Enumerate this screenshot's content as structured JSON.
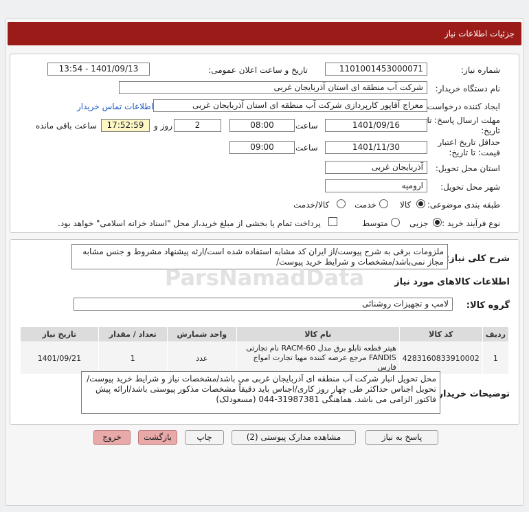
{
  "header": {
    "title": "جزئیات اطلاعات نیاز"
  },
  "form": {
    "need_number": {
      "label": "شماره نیاز:",
      "value": "1101001453000071"
    },
    "announce_datetime": {
      "label": "تاریخ و ساعت اعلان عمومی:",
      "value": "1401/09/13 - 13:54"
    },
    "buyer_org": {
      "label": "نام دستگاه خریدار:",
      "value": "شرکت آب منطقه ای استان آذربایجان غربی"
    },
    "requester": {
      "label": "ایجاد کننده درخواست:",
      "value": "معراج آقاپور کارپردازی شرکت آب منطقه ای استان آذربایجان غربی",
      "contact_link": "اطلاعات تماس خریدار"
    },
    "deadline": {
      "label_line1": "مهلت ارسال پاسخ: تا",
      "label_line2": "تاریخ:",
      "date": "1401/09/16",
      "time_label": "ساعت",
      "time": "08:00",
      "days": "2",
      "days_label": "روز و",
      "remaining": "17:52:59",
      "remaining_label": "ساعت باقی مانده"
    },
    "price_validity": {
      "label_line1": "حداقل تاریخ اعتبار",
      "label_line2": "قیمت: تا تاریخ:",
      "date": "1401/11/30",
      "time_label": "ساعت",
      "time": "09:00"
    },
    "province": {
      "label": "استان محل تحویل:",
      "value": "آذربایجان غربی"
    },
    "city": {
      "label": "شهر محل تحویل:",
      "value": "ارومیه"
    },
    "category": {
      "label": "طبقه بندی موضوعی:",
      "options": [
        "کالا",
        "خدمت",
        "کالا/خدمت"
      ],
      "selected": "کالا"
    },
    "purchase_type": {
      "label": "نوع فرآیند خرید :",
      "options": [
        "جزیی",
        "متوسط"
      ],
      "selected": "جزیی",
      "payment_note": "پرداخت تمام یا بخشی از مبلغ خرید،از محل \"اسناد خزانه اسلامی\" خواهد بود."
    }
  },
  "summary": {
    "label": "شرح کلی نیاز:",
    "text": "ملزومات برقی به شرح پیوست/از ایران کد مشابه استفاده شده است/ارئه پیشنهاد مشروط و جنس مشابه مجاز نمی‌باشد/مشخصات و شرایط خرید پیوست/"
  },
  "goods_section": {
    "title": "اطلاعات کالاهای مورد نیاز",
    "group_label": "گروه کالا:",
    "group_value": "لامپ و تجهیزات روشنائی"
  },
  "table": {
    "headers": [
      "ردیف",
      "کد کالا",
      "نام کالا",
      "واحد شمارش",
      "تعداد / مقدار",
      "تاریخ نیاز"
    ],
    "rows": [
      {
        "row": "1",
        "code": "4283160833910002",
        "name": "هیتر قطعه تابلو برق مدل RACM-60 نام تجارتی FANDIS مرجع عرضه کننده مهیا تجارت امواج فارس",
        "unit": "عدد",
        "qty": "1",
        "date": "1401/09/21"
      }
    ]
  },
  "buyer_notes": {
    "label": "توضیحات خریدار:",
    "text": "محل تحویل انبار شرکت آب منطقه ای آذربایجان غربی می باشد/مشخصات نیاز و شرایط خرید پیوست/تحویل اجناس حداکثر طی چهار روز کاری/اجناس باید دقیقاً مشخصات مذکور پیوستی باشد/ارائه پیش فاکتور الزامی می باشد. هماهنگی 31987381-044 (مسعودلک)"
  },
  "buttons": {
    "reply": "پاسخ به نیاز",
    "attachments": "مشاهده مدارک پیوستی (2)",
    "print": "چاپ",
    "back": "بازگشت",
    "exit": "خروج"
  },
  "watermark": "ParsNamadData"
}
